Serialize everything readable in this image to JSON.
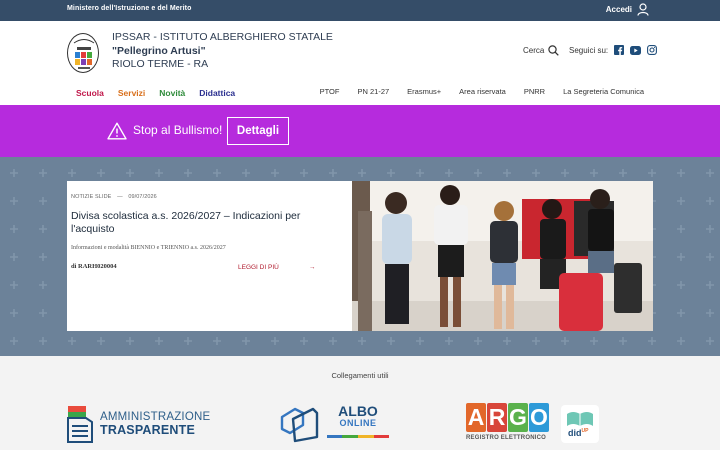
{
  "topbar": {
    "ministry": "Ministero dell'Istruzione e del Merito",
    "login_label": "Accedi",
    "login_icon": "user-icon"
  },
  "header": {
    "school_line1": "IPSSAR - ISTITUTO ALBERGHIERO STATALE",
    "school_line2": "\"Pellegrino Artusi\"",
    "school_line3": "RIOLO TERME - RA",
    "search_label": "Cerca",
    "social_label": "Seguici su:",
    "social_icons": [
      "facebook-icon",
      "youtube-icon",
      "instagram-icon"
    ]
  },
  "nav_main": [
    {
      "label": "Scuola",
      "color": "#c0184a"
    },
    {
      "label": "Servizi",
      "color": "#d9701c"
    },
    {
      "label": "Novità",
      "color": "#2e8b3a"
    },
    {
      "label": "Didattica",
      "color": "#2a2f8f"
    }
  ],
  "nav_secondary": [
    "PTOF",
    "PN 21-27",
    "Erasmus+",
    "Area riservata",
    "PNRR",
    "La Segreteria Comunica"
  ],
  "alert": {
    "message": "Stop al Bullismo!",
    "button": "Dettagli",
    "background": "#b62bdd"
  },
  "news": {
    "category": "NOTIZIE SLIDE",
    "separator": "—",
    "date": "09/07/2026",
    "title": "Divisa scolastica a.s. 2026/2027 – Indicazioni per l'acquisto",
    "description": "Informazioni e modalità BIENNIO e TRIENNIO a.s. 2026/2027",
    "author": "di RARH020004",
    "read_more": "LEGGI DI PIÙ",
    "arrow": "→"
  },
  "useful_links": {
    "label": "Collegamenti utili",
    "amministrazione": {
      "line1": "AMMINISTRAZIONE",
      "line2": "TRASPARENTE"
    },
    "albo": {
      "line1": "ALBO",
      "line2": "ONLINE"
    },
    "argo": {
      "letters": [
        "A",
        "R",
        "G",
        "O"
      ],
      "letter_colors": [
        "#e2672a",
        "#d8463a",
        "#5ab14c",
        "#2d9ad8"
      ],
      "subtitle": "REGISTRO ELETTRONICO"
    },
    "didup": {
      "label": "did",
      "sup": "UP"
    }
  }
}
